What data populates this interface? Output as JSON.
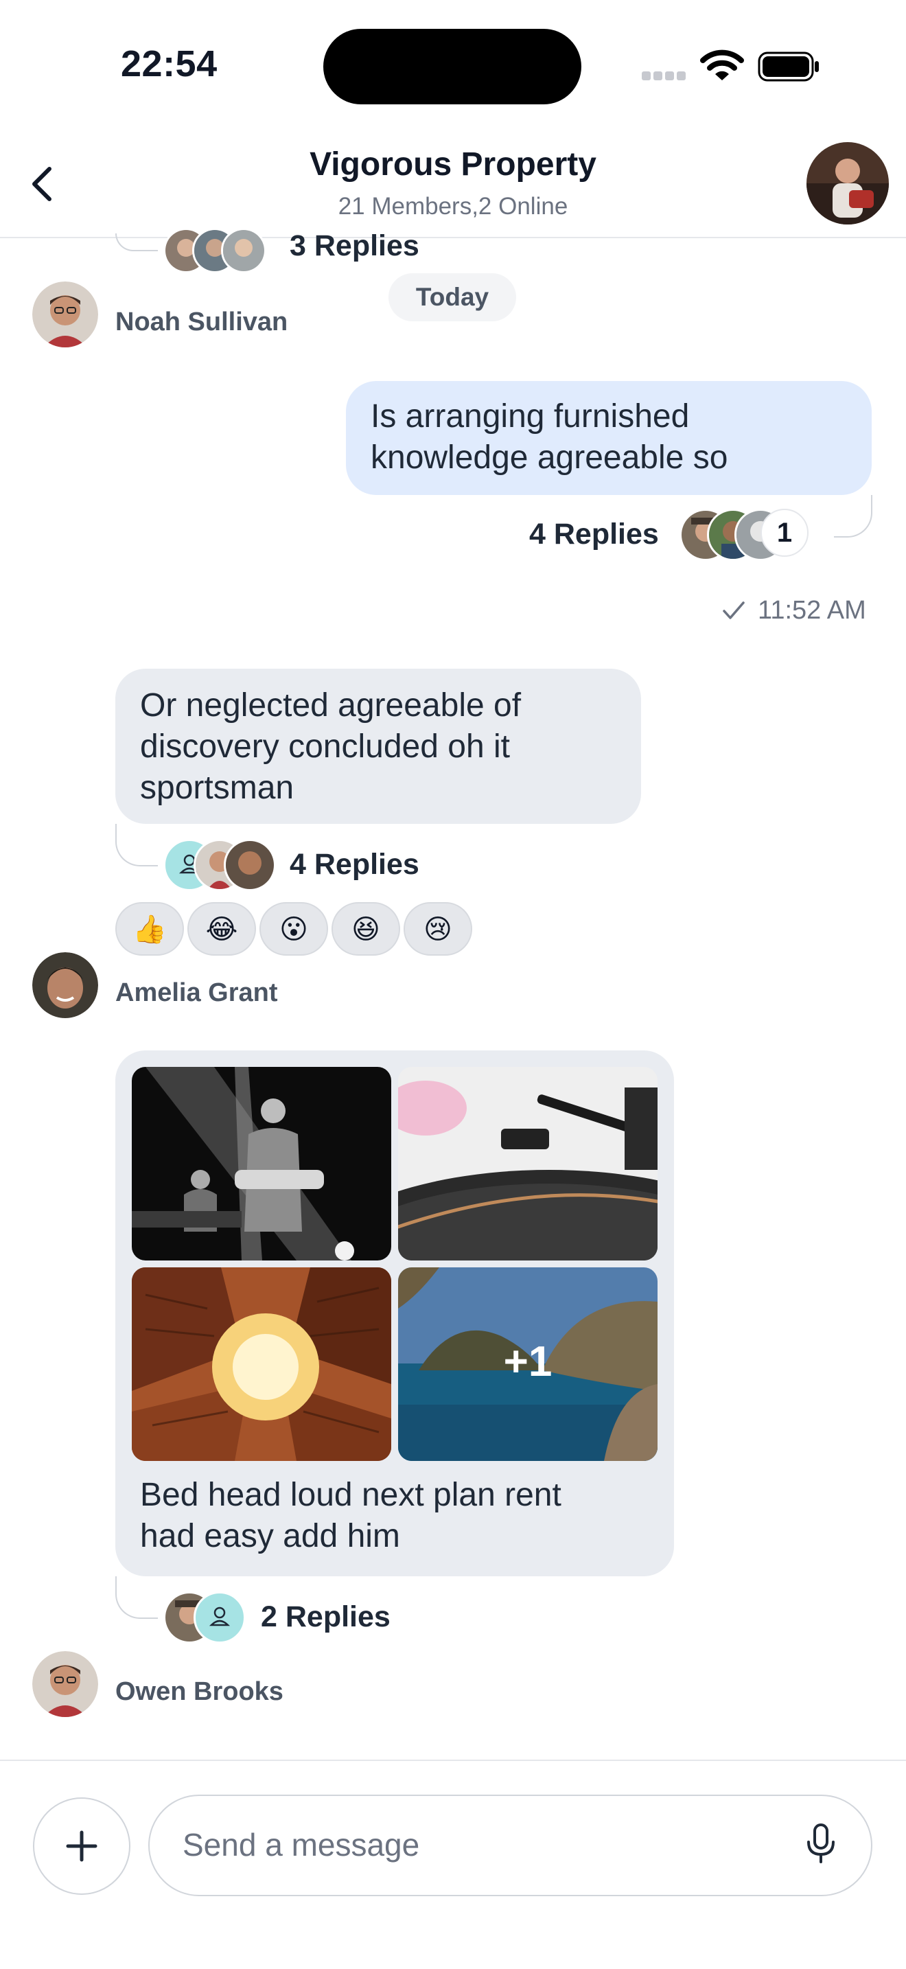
{
  "status_bar": {
    "time": "22:54"
  },
  "header": {
    "title": "Vigorous Property",
    "subtitle": "21 Members,2 Online"
  },
  "date_separator": "Today",
  "messages": [
    {
      "sender": "",
      "replies": "3 Replies"
    },
    {
      "sender": "Noah Sullivan"
    },
    {
      "outgoing": true,
      "text_line1": "Is arranging furnished",
      "text_line2": "knowledge agreeable so",
      "replies": "4 Replies",
      "reader_count": "1",
      "time": "11:52 AM"
    },
    {
      "text_line1": "Or neglected agreeable of",
      "text_line2": "discovery concluded oh it",
      "text_line3": "sportsman",
      "replies": "4 Replies",
      "reactions": [
        "👍",
        "😂",
        "😮",
        "😆",
        "😢"
      ]
    },
    {
      "sender": "Amelia Grant"
    },
    {
      "image_more_count": "+1",
      "text_line1": "Bed head loud next plan rent",
      "text_line2": "had easy add him",
      "replies": "2 Replies"
    },
    {
      "sender": "Owen Brooks"
    }
  ],
  "composer": {
    "placeholder": "Send a message"
  },
  "icons": {
    "back": "chevron-left-icon",
    "plus": "plus-icon",
    "mic": "microphone-icon",
    "check": "checkmark-icon",
    "wifi": "wifi-icon",
    "battery": "battery-icon"
  },
  "colors": {
    "outgoing_bubble": "#e0ebfd",
    "incoming_bubble": "#e9ecf1",
    "text": "#1f2937"
  }
}
